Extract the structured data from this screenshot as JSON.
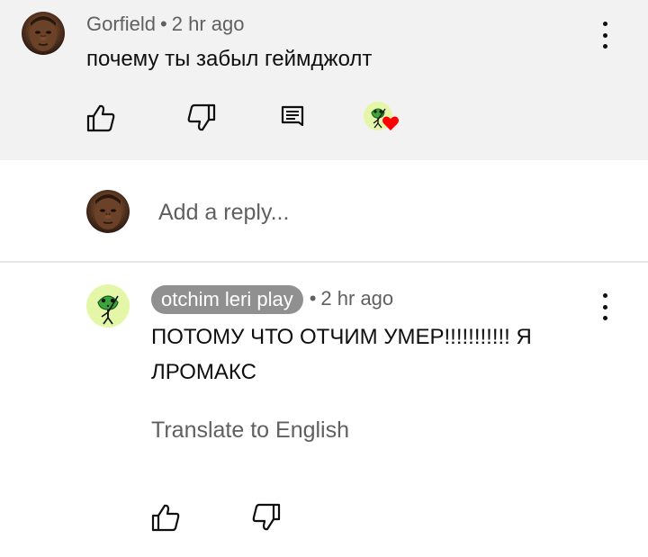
{
  "top_comment": {
    "author": "Gorfield",
    "separator": "•",
    "time": "2 hr ago",
    "text": "почему ты забыл геймджолт",
    "avatar_icon": "man-face-avatar",
    "actions": [
      "like-icon",
      "dislike-icon",
      "reply-icon"
    ],
    "hearted_by_creator": true
  },
  "reply_box": {
    "placeholder": "Add a reply..."
  },
  "reply_comment": {
    "author": "otchim leri play",
    "separator": "•",
    "time": "2 hr ago",
    "text": "ПОТОМУ ЧТО ОТЧИМ УМЕР!!!!!!!!!!! Я ЛРОМАКС",
    "translate_label": "Translate to English",
    "avatar_icon": "frog-drawing-avatar",
    "actions": [
      "like-icon",
      "dislike-icon"
    ]
  },
  "colors": {
    "highlight_bg": "#f2f2f2",
    "secondary_text": "#606060",
    "author_chip_bg": "#909090",
    "heart": "#ff0000",
    "frog_avatar_bg": "#e4f7a8"
  }
}
